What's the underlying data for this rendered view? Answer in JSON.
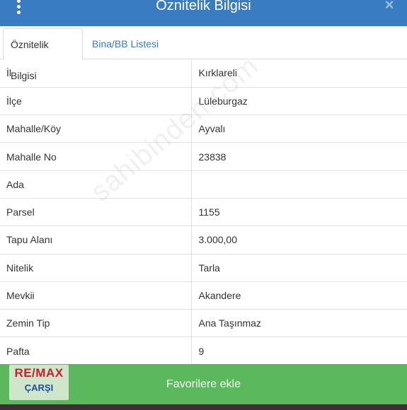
{
  "header": {
    "title": "Öznitelik Bilgisi",
    "menu_icon": "more-vertical-icon",
    "close_label": "×",
    "color": "#3a7cc1"
  },
  "tabs": [
    {
      "label": "Öznitelik Bilgisi",
      "active": true
    },
    {
      "label": "Bina/BB Listesi",
      "active": false
    }
  ],
  "attributes": [
    {
      "key": "İl",
      "value": "Kırklareli"
    },
    {
      "key": "İlçe",
      "value": "Lüleburgaz"
    },
    {
      "key": "Mahalle/Köy",
      "value": "Ayvalı"
    },
    {
      "key": "Mahalle No",
      "value": "23838"
    },
    {
      "key": "Ada",
      "value": ""
    },
    {
      "key": "Parsel",
      "value": "1155"
    },
    {
      "key": "Tapu Alanı",
      "value": "3.000,00"
    },
    {
      "key": "Nitelik",
      "value": "Tarla"
    },
    {
      "key": "Mevkii",
      "value": "Akandere"
    },
    {
      "key": "Zemin Tip",
      "value": "Ana Taşınmaz"
    },
    {
      "key": "Pafta",
      "value": "9"
    }
  ],
  "favorite_button": {
    "label": "Favorilere ekle",
    "color": "#5cb85c"
  },
  "watermark": {
    "text": "sahibinden.com"
  },
  "logo": {
    "main": "RE/MAX",
    "sub": "ÇARŞI"
  }
}
